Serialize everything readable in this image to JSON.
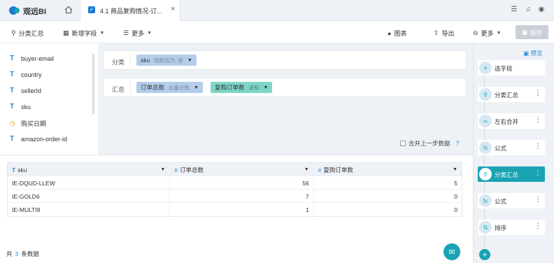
{
  "app": {
    "brand": "观远BI"
  },
  "tab": {
    "title": "4.1 商品复购情况-订...",
    "close": "×"
  },
  "toolbar": {
    "group_summary": "分类汇总",
    "add_field": "新增字段",
    "more_left": "更多",
    "chart": "图表",
    "export": "导出",
    "more_right": "更多",
    "save": "保存"
  },
  "fields": [
    {
      "type": "T",
      "name": "buyer-email"
    },
    {
      "type": "T",
      "name": "country"
    },
    {
      "type": "T",
      "name": "sellerId"
    },
    {
      "type": "T",
      "name": "sku"
    },
    {
      "type": "date",
      "name": "购买日期"
    },
    {
      "type": "T",
      "name": "amazon-order-id"
    }
  ],
  "config": {
    "group_label": "分类",
    "group_chip": {
      "name": "sku",
      "sub": "组距值为: 是"
    },
    "summary_label": "汇总",
    "summary_chips": [
      {
        "name": "订单总数",
        "sub": "去重计数"
      },
      {
        "name": "复购订单数",
        "sub": "求和"
      }
    ],
    "merge_label": "合并上一步数据",
    "help_icon": "?"
  },
  "table": {
    "columns": [
      "sku",
      "订单总数",
      "复购订单数"
    ],
    "rows": [
      [
        "IE-DQUD-LLEW",
        "56",
        "5"
      ],
      [
        "IE-GOLD6",
        "7",
        "0"
      ],
      [
        "IE-MULTI8",
        "1",
        "0"
      ]
    ],
    "count_prefix": "共",
    "count_value": "3",
    "count_suffix": "条数据"
  },
  "right_panel": {
    "preview": "预览",
    "steps": [
      {
        "label": "选字段",
        "icon": "≡",
        "active": false,
        "more": false
      },
      {
        "label": "分类汇总",
        "icon": "⚲",
        "active": false,
        "more": true
      },
      {
        "label": "左右合并",
        "icon": "∞",
        "active": false,
        "more": true
      },
      {
        "label": "公式",
        "icon": "fx",
        "active": false,
        "more": true
      },
      {
        "label": "分类汇总",
        "icon": "⚲",
        "active": true,
        "more": true
      },
      {
        "label": "公式",
        "icon": "fx",
        "active": false,
        "more": true
      },
      {
        "label": "排序",
        "icon": "⇅",
        "active": false,
        "more": true
      }
    ],
    "add": "+"
  },
  "colors": {
    "accent": "#19a3b3",
    "blue": "#2a8bd8",
    "chip_blue": "#b3cdea",
    "chip_green": "#7fd6c8"
  }
}
